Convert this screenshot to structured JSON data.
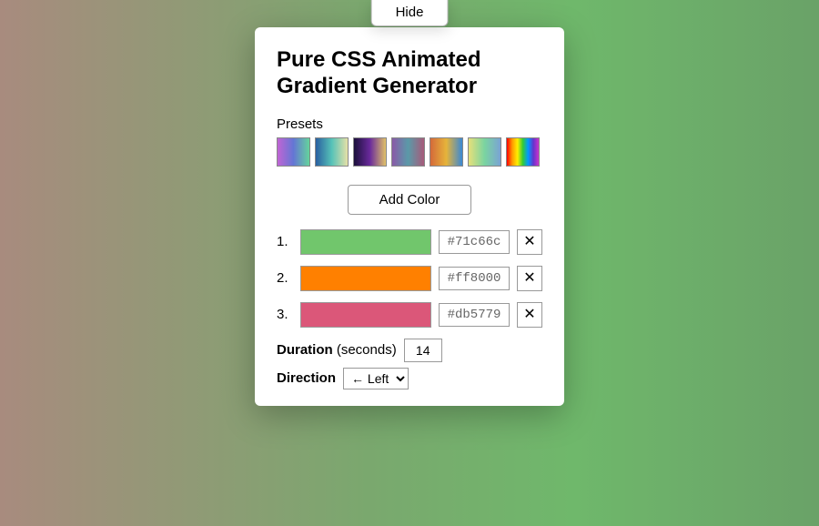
{
  "hide_label": "Hide",
  "title": "Pure CSS Animated Gradient Generator",
  "presets_label": "Presets",
  "preset_gradients": [
    "linear-gradient(90deg,#c064d4,#6476d4,#64d49c)",
    "linear-gradient(90deg,#2a5fa0,#56c2b8,#e6e1a7)",
    "linear-gradient(90deg,#1b103b,#6a2a9c,#e0c268)",
    "linear-gradient(90deg,#8a5aa8,#5a9aa8,#a85a7a)",
    "linear-gradient(90deg,#d46a3a,#e6b43a,#3a88d4)",
    "linear-gradient(90deg,#e5e07a,#7ad4a0,#7aa3d4)",
    "linear-gradient(90deg,#ff0000,#ff9900,#ffee00,#33cc33,#0099ff,#6633cc,#cc33cc)"
  ],
  "add_color_label": "Add Color",
  "colors": [
    {
      "idx": "1.",
      "hex": "#71c66c"
    },
    {
      "idx": "2.",
      "hex": "#ff8000"
    },
    {
      "idx": "3.",
      "hex": "#db5779"
    }
  ],
  "duration": {
    "label_bold": "Duration",
    "label_rest": " (seconds)",
    "value": "14"
  },
  "direction": {
    "label": "Direction",
    "value": "← Left"
  }
}
